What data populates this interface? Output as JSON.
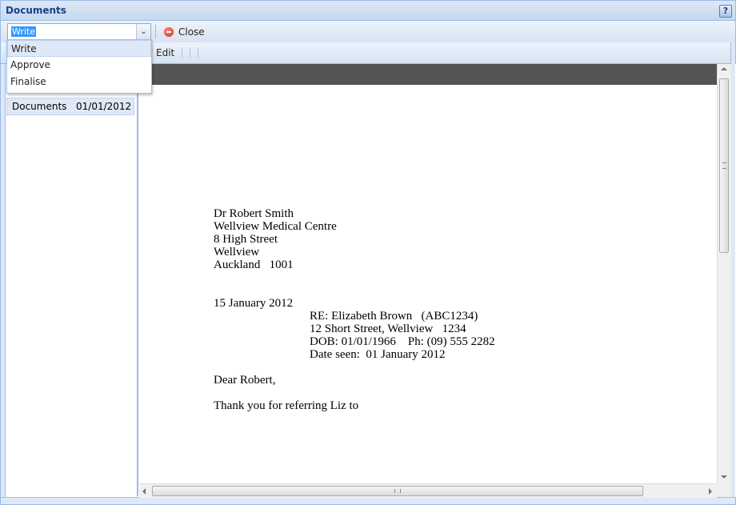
{
  "window": {
    "title": "Documents",
    "help_label": "?"
  },
  "toolbar": {
    "status_select": {
      "value": "Write",
      "options": [
        "Write",
        "Approve",
        "Finalise"
      ]
    },
    "close_label": "Close",
    "edit_label": "Edit"
  },
  "documents_list": [
    {
      "name": "Documents",
      "date": "01/01/2012"
    }
  ],
  "letter": {
    "address": [
      "Dr Robert Smith",
      "Wellview Medical Centre",
      "8 High Street",
      "Wellview",
      "Auckland   1001"
    ],
    "date": "15 January 2012",
    "re_block": [
      "RE: Elizabeth Brown   (ABC1234)",
      "12 Short Street, Wellview   1234",
      "DOB: 01/01/1966    Ph: (09) 555 2282",
      "Date seen:  01 January 2012"
    ],
    "salutation": "Dear Robert,",
    "body": "Thank you for referring Liz to"
  }
}
